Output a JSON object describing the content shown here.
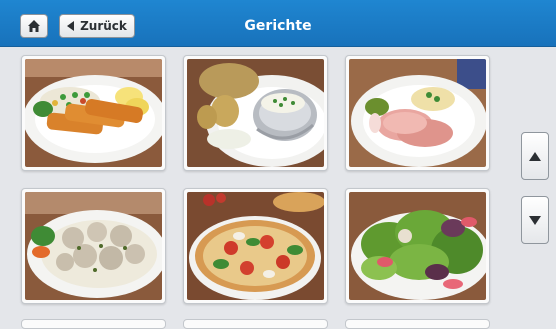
{
  "header": {
    "title": "Gerichte",
    "back_label": "Zurück",
    "home_icon": "home-icon",
    "back_icon": "triangle-left-icon",
    "background_color": "#1a7cc6"
  },
  "dishes": [
    {
      "id": "fish-fingers-rice",
      "icon": "food-photo"
    },
    {
      "id": "baked-potato",
      "icon": "food-photo"
    },
    {
      "id": "ham-sauerkraut",
      "icon": "food-photo"
    },
    {
      "id": "meatballs-caper-sauce",
      "icon": "food-photo"
    },
    {
      "id": "pizza",
      "icon": "food-photo"
    },
    {
      "id": "mixed-salad",
      "icon": "food-photo"
    }
  ],
  "scroll": {
    "up_icon": "triangle-up-icon",
    "down_icon": "triangle-down-icon"
  }
}
